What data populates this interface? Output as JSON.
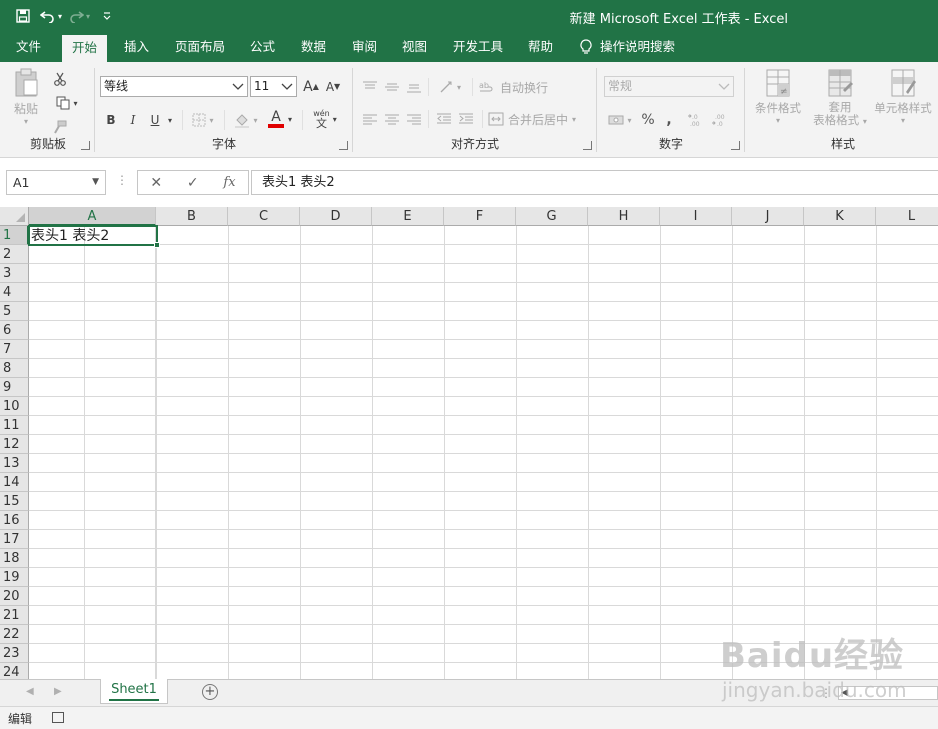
{
  "window": {
    "title": "新建 Microsoft Excel 工作表  -  Excel"
  },
  "qat": {
    "save_icon": "save-icon",
    "undo_icon": "undo-icon",
    "redo_icon": "redo-icon",
    "customize_icon": "chevron-down-icon"
  },
  "tabs": [
    {
      "label": "文件"
    },
    {
      "label": "开始"
    },
    {
      "label": "插入"
    },
    {
      "label": "页面布局"
    },
    {
      "label": "公式"
    },
    {
      "label": "数据"
    },
    {
      "label": "审阅"
    },
    {
      "label": "视图"
    },
    {
      "label": "开发工具"
    },
    {
      "label": "帮助"
    }
  ],
  "tellme": {
    "label": "操作说明搜索",
    "icon": "lightbulb-icon"
  },
  "ribbon": {
    "clipboard": {
      "label": "剪贴板",
      "paste": "粘贴"
    },
    "font": {
      "label": "字体",
      "family": "等线",
      "size": "11",
      "bold": "B",
      "italic": "I",
      "underline": "U",
      "grow": "A",
      "shrink": "A",
      "font_color": "A",
      "phonetic_top": "wén",
      "phonetic_bottom": "文"
    },
    "alignment": {
      "label": "对齐方式",
      "wrap": "自动换行",
      "merge": "合并后居中"
    },
    "number": {
      "label": "数字",
      "format": "常规",
      "percent": "%",
      "comma": ","
    },
    "styles": {
      "label": "样式",
      "conditional": "条件格式",
      "table_line1": "套用",
      "table_line2": "表格格式",
      "cell_styles": "单元格样式"
    }
  },
  "formula_bar": {
    "name_box": "A1",
    "cancel": "✕",
    "enter": "✓",
    "fx": "fx",
    "value": "表头1 表头2"
  },
  "grid": {
    "columns": [
      "A",
      "B",
      "C",
      "D",
      "E",
      "F",
      "G",
      "H",
      "I",
      "J",
      "K",
      "L"
    ],
    "rows": [
      "1",
      "2",
      "3",
      "4",
      "5",
      "6",
      "7",
      "8",
      "9",
      "10",
      "11",
      "12",
      "13",
      "14",
      "15",
      "16",
      "17",
      "18",
      "19",
      "20",
      "21",
      "22",
      "23",
      "24"
    ],
    "selected_column": "A",
    "selected_row": "1",
    "a1_value": "表头1 表头2"
  },
  "sheets": [
    {
      "label": "Sheet1",
      "active": true
    }
  ],
  "status": {
    "mode": "编辑"
  },
  "watermark": {
    "brand": "Baidu经验",
    "url": "jingyan.baidu.com"
  },
  "colors": {
    "accent": "#217346",
    "ribbon_bg": "#f3f3f3",
    "font_color_bar": "#e00000"
  }
}
